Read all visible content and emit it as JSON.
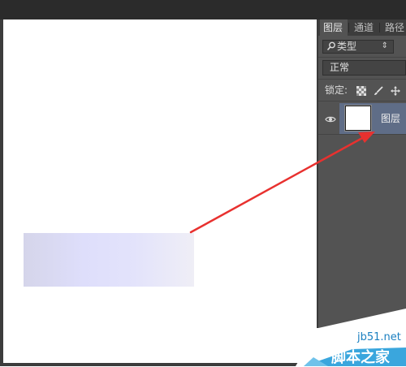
{
  "layers_panel": {
    "tabs": [
      {
        "label": "图层",
        "active": true
      },
      {
        "label": "通道",
        "active": false
      },
      {
        "label": "路径",
        "active": false
      }
    ],
    "filter": {
      "icon": "search-icon",
      "label": "类型",
      "spinner": "⇕"
    },
    "blend_mode": "正常",
    "lock": {
      "label": "锁定:",
      "icons": [
        "lock-transparent-icon",
        "lock-brush-icon",
        "lock-move-icon"
      ]
    },
    "layers": [
      {
        "name": "图层",
        "visible": true,
        "selected": true,
        "thumbnail_color": "#ffffff"
      }
    ]
  },
  "canvas": {
    "background": "#ffffff",
    "shape_gradient": [
      "#d5d5ea",
      "#dedefb",
      "#efeef6"
    ]
  },
  "annotation": {
    "arrow_color": "#e8312f"
  },
  "watermark": {
    "domain": "jb51.net",
    "name": "脚本之家",
    "accent": "#3aa6dd"
  }
}
